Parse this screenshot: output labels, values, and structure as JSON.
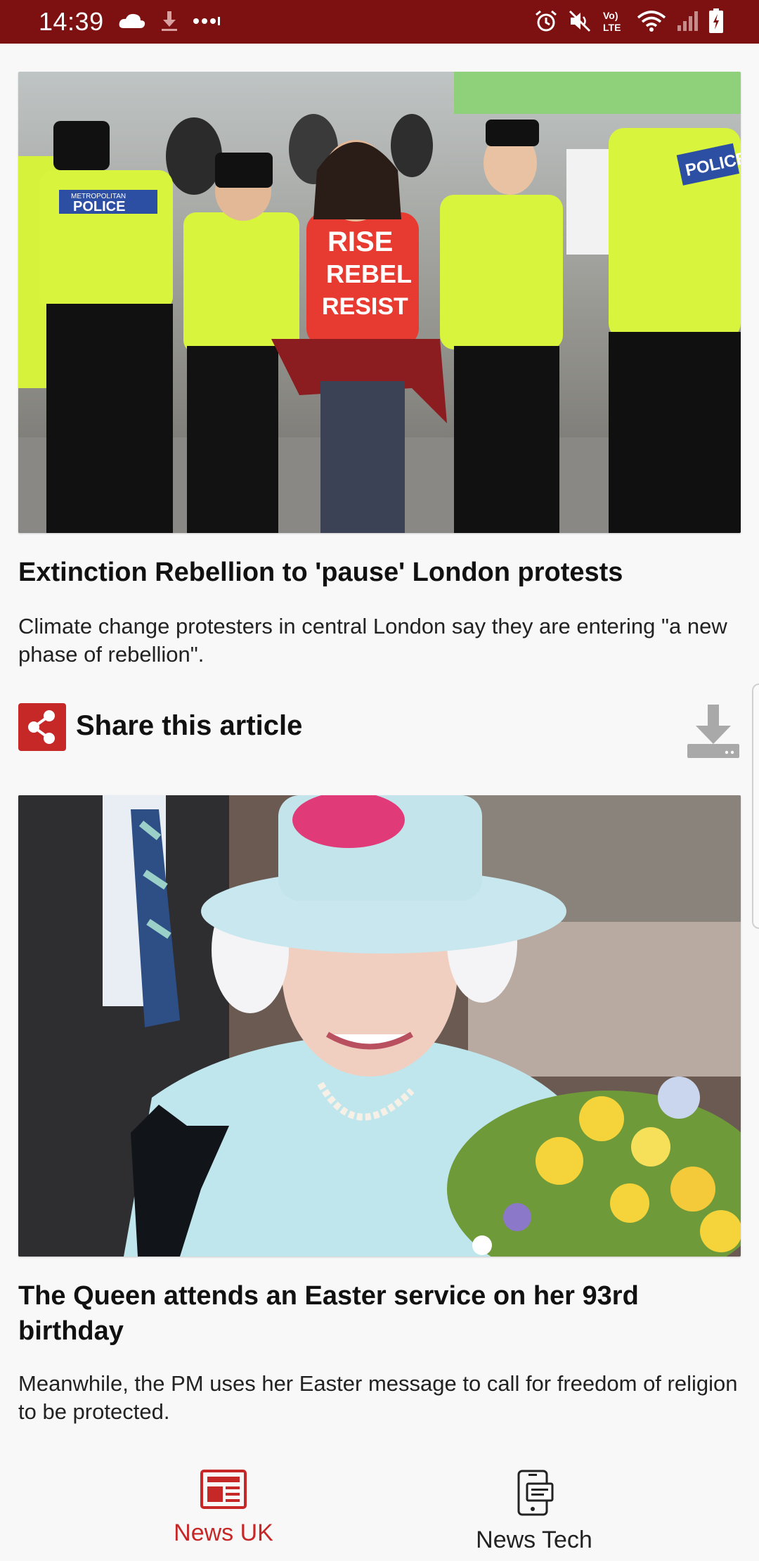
{
  "status_bar": {
    "time": "14:39",
    "background": "#7d1011"
  },
  "articles": [
    {
      "title": "Extinction Rebellion to 'pause' London protests",
      "summary": "Climate change protesters in central London say they are entering \"a new phase of rebellion\".",
      "image_alt": "Protester in red T-shirt escorted by police officers",
      "image_text": {
        "shirt_line1": "RISE",
        "shirt_line2": "REBEL",
        "shirt_line3": "RESIST",
        "vest_left": "POLICE",
        "vest_left_top": "METROPOLITAN",
        "vest_right": "POLICE"
      }
    },
    {
      "title": "The Queen attends an Easter service on her 93rd birthday",
      "summary": "Meanwhile, the PM uses her Easter message to call for freedom of religion to be protected.",
      "image_alt": "The Queen in a pale blue hat holding a bouquet of flowers"
    }
  ],
  "share": {
    "label": "Share this article",
    "icon": "share-icon",
    "download_icon": "download-icon"
  },
  "bottom_nav": {
    "items": [
      {
        "label": "News UK",
        "icon": "newspaper-icon",
        "active": true
      },
      {
        "label": "News Tech",
        "icon": "phone-icon",
        "active": false
      }
    ]
  },
  "colors": {
    "accent": "#c62828",
    "status_bar": "#7d1011",
    "background": "#f8f8f8"
  }
}
